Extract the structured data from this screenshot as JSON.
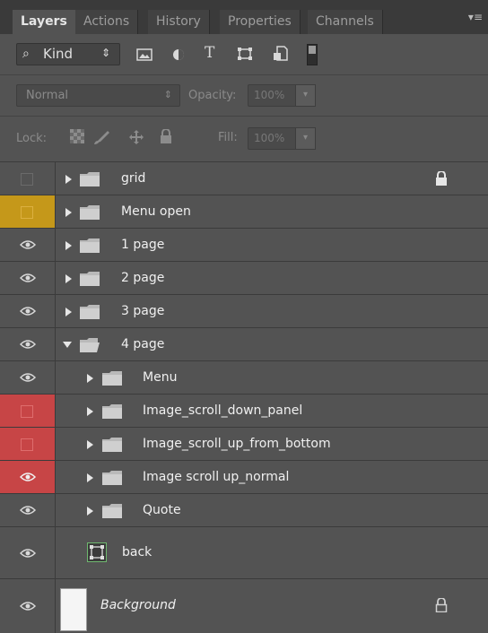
{
  "tabs": [
    {
      "label": "Layers",
      "active": true
    },
    {
      "label": "Actions",
      "active": false
    },
    {
      "label": "History",
      "active": false
    },
    {
      "label": "Properties",
      "active": false
    },
    {
      "label": "Channels",
      "active": false
    }
  ],
  "panel_menu_icon": "panel-menu-icon",
  "filter": {
    "kind_label": "Kind",
    "search_icon": "search-icon",
    "select_arrow": "⇕",
    "filter_icons": [
      "image-filter-icon",
      "adjustment-filter-icon",
      "type-filter-icon",
      "shape-filter-icon",
      "smart-object-filter-icon"
    ],
    "type_glyph": "T"
  },
  "blend": {
    "mode": "Normal",
    "arrow": "⇕",
    "opacity_label": "Opacity:",
    "opacity_value": "100%"
  },
  "lock": {
    "label": "Lock:",
    "icons": [
      "lock-transparent-icon",
      "lock-image-icon",
      "lock-position-icon",
      "lock-all-icon"
    ],
    "fill_label": "Fill:",
    "fill_value": "100%"
  },
  "layers": [
    {
      "name": "grid",
      "kind": "group",
      "visibility": "hidden",
      "color": "none",
      "expanded": false,
      "indent": 0,
      "locked": true
    },
    {
      "name": "Menu open",
      "kind": "group",
      "visibility": "hidden",
      "color": "yellow",
      "expanded": false,
      "indent": 0,
      "locked": false
    },
    {
      "name": "1 page",
      "kind": "group",
      "visibility": "visible",
      "color": "none",
      "expanded": false,
      "indent": 0,
      "locked": false
    },
    {
      "name": "2 page",
      "kind": "group",
      "visibility": "visible",
      "color": "none",
      "expanded": false,
      "indent": 0,
      "locked": false
    },
    {
      "name": "3 page",
      "kind": "group",
      "visibility": "visible",
      "color": "none",
      "expanded": false,
      "indent": 0,
      "locked": false
    },
    {
      "name": "4 page",
      "kind": "group",
      "visibility": "visible",
      "color": "none",
      "expanded": true,
      "indent": 0,
      "locked": false
    },
    {
      "name": "Menu",
      "kind": "group",
      "visibility": "visible",
      "color": "none",
      "expanded": false,
      "indent": 1,
      "locked": false
    },
    {
      "name": "Image_scroll_down_panel",
      "kind": "group",
      "visibility": "hidden",
      "color": "red",
      "expanded": false,
      "indent": 1,
      "locked": false
    },
    {
      "name": "Image_scroll_up_from_bottom",
      "kind": "group",
      "visibility": "hidden",
      "color": "red",
      "expanded": false,
      "indent": 1,
      "locked": false
    },
    {
      "name": "Image scroll up_normal",
      "kind": "group",
      "visibility": "visible",
      "color": "red",
      "expanded": false,
      "indent": 1,
      "locked": false
    },
    {
      "name": "Quote",
      "kind": "group",
      "visibility": "visible",
      "color": "none",
      "expanded": false,
      "indent": 1,
      "locked": false
    },
    {
      "name": "back",
      "kind": "shape",
      "visibility": "visible",
      "color": "none",
      "indent": 1,
      "locked": false
    },
    {
      "name": "Background",
      "kind": "background",
      "visibility": "visible",
      "color": "none",
      "indent": 0,
      "locked": true
    }
  ],
  "colors": {
    "panel": "#535353",
    "tabbar": "#3a3a3a",
    "label_yellow": "#c5981a",
    "label_red": "#c74546"
  }
}
